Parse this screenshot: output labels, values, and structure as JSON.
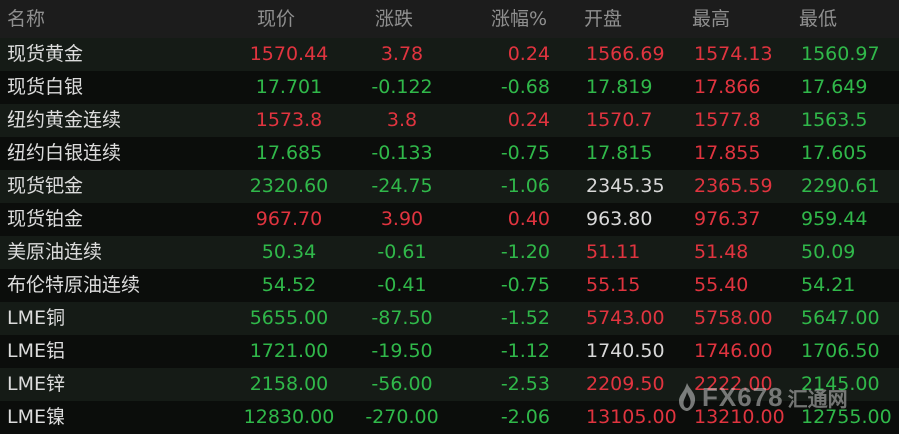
{
  "header": {
    "name": "名称",
    "price": "现价",
    "change": "涨跌",
    "change_pct": "涨幅%",
    "open": "开盘",
    "high": "最高",
    "low": "最低"
  },
  "rows": [
    {
      "name": "现货黄金",
      "price": "1570.44",
      "change": "3.78",
      "pct": "0.24",
      "open": "1566.69",
      "high": "1574.13",
      "low": "1560.97",
      "price_dir": "up",
      "change_dir": "up",
      "pct_dir": "up",
      "open_dir": "up",
      "high_dir": "up",
      "low_dir": "down"
    },
    {
      "name": "现货白银",
      "price": "17.701",
      "change": "-0.122",
      "pct": "-0.68",
      "open": "17.819",
      "high": "17.866",
      "low": "17.649",
      "price_dir": "down",
      "change_dir": "down",
      "pct_dir": "down",
      "open_dir": "down",
      "high_dir": "up",
      "low_dir": "down"
    },
    {
      "name": "纽约黄金连续",
      "price": "1573.8",
      "change": "3.8",
      "pct": "0.24",
      "open": "1570.7",
      "high": "1577.8",
      "low": "1563.5",
      "price_dir": "up",
      "change_dir": "up",
      "pct_dir": "up",
      "open_dir": "up",
      "high_dir": "up",
      "low_dir": "down"
    },
    {
      "name": "纽约白银连续",
      "price": "17.685",
      "change": "-0.133",
      "pct": "-0.75",
      "open": "17.815",
      "high": "17.855",
      "low": "17.605",
      "price_dir": "down",
      "change_dir": "down",
      "pct_dir": "down",
      "open_dir": "down",
      "high_dir": "up",
      "low_dir": "down"
    },
    {
      "name": "现货钯金",
      "price": "2320.60",
      "change": "-24.75",
      "pct": "-1.06",
      "open": "2345.35",
      "high": "2365.59",
      "low": "2290.61",
      "price_dir": "down",
      "change_dir": "down",
      "pct_dir": "down",
      "open_dir": "flat",
      "high_dir": "up",
      "low_dir": "down"
    },
    {
      "name": "现货铂金",
      "price": "967.70",
      "change": "3.90",
      "pct": "0.40",
      "open": "963.80",
      "high": "976.37",
      "low": "959.44",
      "price_dir": "up",
      "change_dir": "up",
      "pct_dir": "up",
      "open_dir": "flat",
      "high_dir": "up",
      "low_dir": "down"
    },
    {
      "name": "美原油连续",
      "price": "50.34",
      "change": "-0.61",
      "pct": "-1.20",
      "open": "51.11",
      "high": "51.48",
      "low": "50.09",
      "price_dir": "down",
      "change_dir": "down",
      "pct_dir": "down",
      "open_dir": "up",
      "high_dir": "up",
      "low_dir": "down"
    },
    {
      "name": "布伦特原油连续",
      "price": "54.52",
      "change": "-0.41",
      "pct": "-0.75",
      "open": "55.15",
      "high": "55.40",
      "low": "54.21",
      "price_dir": "down",
      "change_dir": "down",
      "pct_dir": "down",
      "open_dir": "up",
      "high_dir": "up",
      "low_dir": "down"
    },
    {
      "name": "LME铜",
      "price": "5655.00",
      "change": "-87.50",
      "pct": "-1.52",
      "open": "5743.00",
      "high": "5758.00",
      "low": "5647.00",
      "price_dir": "down",
      "change_dir": "down",
      "pct_dir": "down",
      "open_dir": "up",
      "high_dir": "up",
      "low_dir": "down"
    },
    {
      "name": "LME铝",
      "price": "1721.00",
      "change": "-19.50",
      "pct": "-1.12",
      "open": "1740.50",
      "high": "1746.00",
      "low": "1706.50",
      "price_dir": "down",
      "change_dir": "down",
      "pct_dir": "down",
      "open_dir": "flat",
      "high_dir": "up",
      "low_dir": "down"
    },
    {
      "name": "LME锌",
      "price": "2158.00",
      "change": "-56.00",
      "pct": "-2.53",
      "open": "2209.50",
      "high": "2222.00",
      "low": "2145.00",
      "price_dir": "down",
      "change_dir": "down",
      "pct_dir": "down",
      "open_dir": "up",
      "high_dir": "up",
      "low_dir": "down"
    },
    {
      "name": "LME镍",
      "price": "12830.00",
      "change": "-270.00",
      "pct": "-2.06",
      "open": "13105.00",
      "high": "13210.00",
      "low": "12755.00",
      "price_dir": "down",
      "change_dir": "down",
      "pct_dir": "down",
      "open_dir": "up",
      "high_dir": "up",
      "low_dir": "down"
    }
  ],
  "watermark": {
    "logo_text": "FX678",
    "sub_text": "汇通网",
    "icon": "fx678-flame-logo-icon"
  },
  "colors": {
    "up": "#e0343f",
    "down": "#30b84a",
    "flat": "#d8d8d8",
    "background": "#0b0b0b",
    "header_bg": "#1c1c1c"
  }
}
